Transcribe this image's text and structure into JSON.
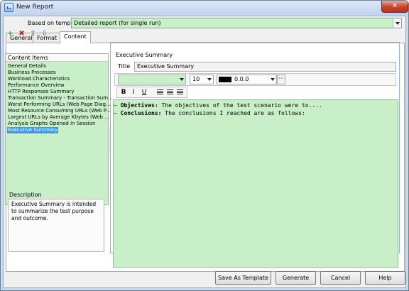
{
  "window": {
    "title": "New Report",
    "close_glyph": "✕"
  },
  "template": {
    "label": "Based on template",
    "value": "Detailed report (for single run)"
  },
  "tabs": [
    {
      "label": "General"
    },
    {
      "label": "Format"
    },
    {
      "label": "Content",
      "active": true
    }
  ],
  "toolbar": {
    "icons": [
      "add-icon",
      "delete-icon",
      "move-up-icon",
      "move-down-icon"
    ]
  },
  "content_items": {
    "header": "Content Items",
    "items": [
      "General Details",
      "Business Processes",
      "Workload Characteristics",
      "Performance Overview",
      "HTTP Responses Summary",
      "Transaction Summary - Transaction Sum...",
      "Worst Performing URLs (Web Page Diag...",
      "Most Resource Consuming URLs (Web P...",
      "Largest URLs by Average Kbytes (Web ...",
      "Analysis Graphs Opened in Session",
      "Executive Summary"
    ],
    "selected_index": 10
  },
  "description": {
    "label": "Description",
    "text": "Executive Summary is intended to summarize the test purpose and outcome."
  },
  "editor_group": {
    "label": "Executive Summary",
    "title_label": "Title",
    "title_value": "Executive Summary",
    "font_value": "",
    "size_value": "10",
    "color_value": "0.0.0",
    "color_swatch": "#000000",
    "style_buttons": [
      "B",
      "I",
      "U"
    ],
    "lines": [
      {
        "bullet": "—",
        "label": "Objectives:",
        "text": "The objectives of the test scenario were to...."
      },
      {
        "bullet": "—",
        "label": "Conclusions:",
        "text": "The conclusions I reached are as follows:"
      }
    ]
  },
  "buttons": {
    "save_template": "Save As Template",
    "generate": "Generate",
    "cancel": "Cancel",
    "help": "Help"
  },
  "colors": {
    "field_green": "#c9efc9",
    "selection_blue": "#3399ff",
    "close_red": "#c9412b"
  }
}
